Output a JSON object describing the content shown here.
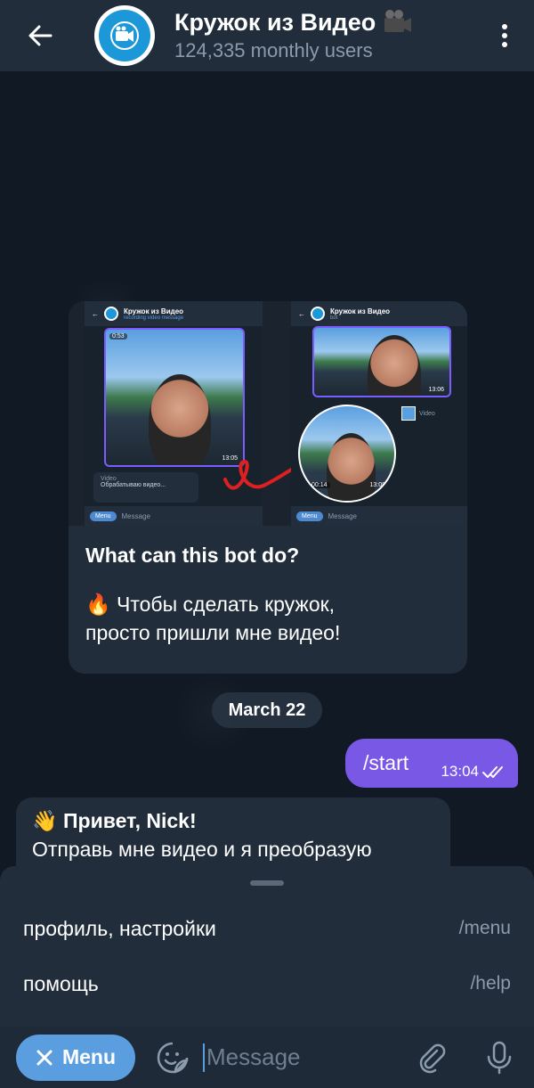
{
  "header": {
    "title": "Кружок из Видео",
    "title_icon": "video-camera-icon",
    "subtitle": "124,335 monthly users"
  },
  "intro_card": {
    "preview": {
      "left_phone": {
        "title": "Кружок из Видео",
        "status": "recording video message",
        "video_duration": "0:53",
        "video_time": "13:05",
        "video_label": "Video",
        "processing_text": "Обрабатываю видео...",
        "menu_label": "Menu",
        "input_placeholder": "Message"
      },
      "right_phone": {
        "title": "Кружок из Видео",
        "status": "bot",
        "video_time": "13:06",
        "circle_time": "13:08",
        "circle_duration": "00:14",
        "video_label": "Video",
        "menu_label": "Menu",
        "input_placeholder": "Message"
      }
    },
    "title": "What can this bot do?",
    "text_line1": "🔥 Чтобы сделать кружок,",
    "text_line2": "просто пришли мне видео!"
  },
  "date_separator": "March 22",
  "outgoing": {
    "text": "/start",
    "time": "13:04",
    "status_icon": "double-check-icon"
  },
  "incoming": {
    "line1": "👋 Привет, Nick!",
    "line2": "Отправь мне видео и я преобразую"
  },
  "bot_commands": [
    {
      "label": "профиль, настройки",
      "command": "/menu"
    },
    {
      "label": "помощь",
      "command": "/help"
    }
  ],
  "input_bar": {
    "menu_label": "Menu",
    "placeholder": "Message"
  },
  "colors": {
    "header_bg": "#212d3b",
    "outgoing_bubble": "#7a58e6",
    "menu_button": "#5b9ee0",
    "subtitle": "#8b9bab"
  }
}
